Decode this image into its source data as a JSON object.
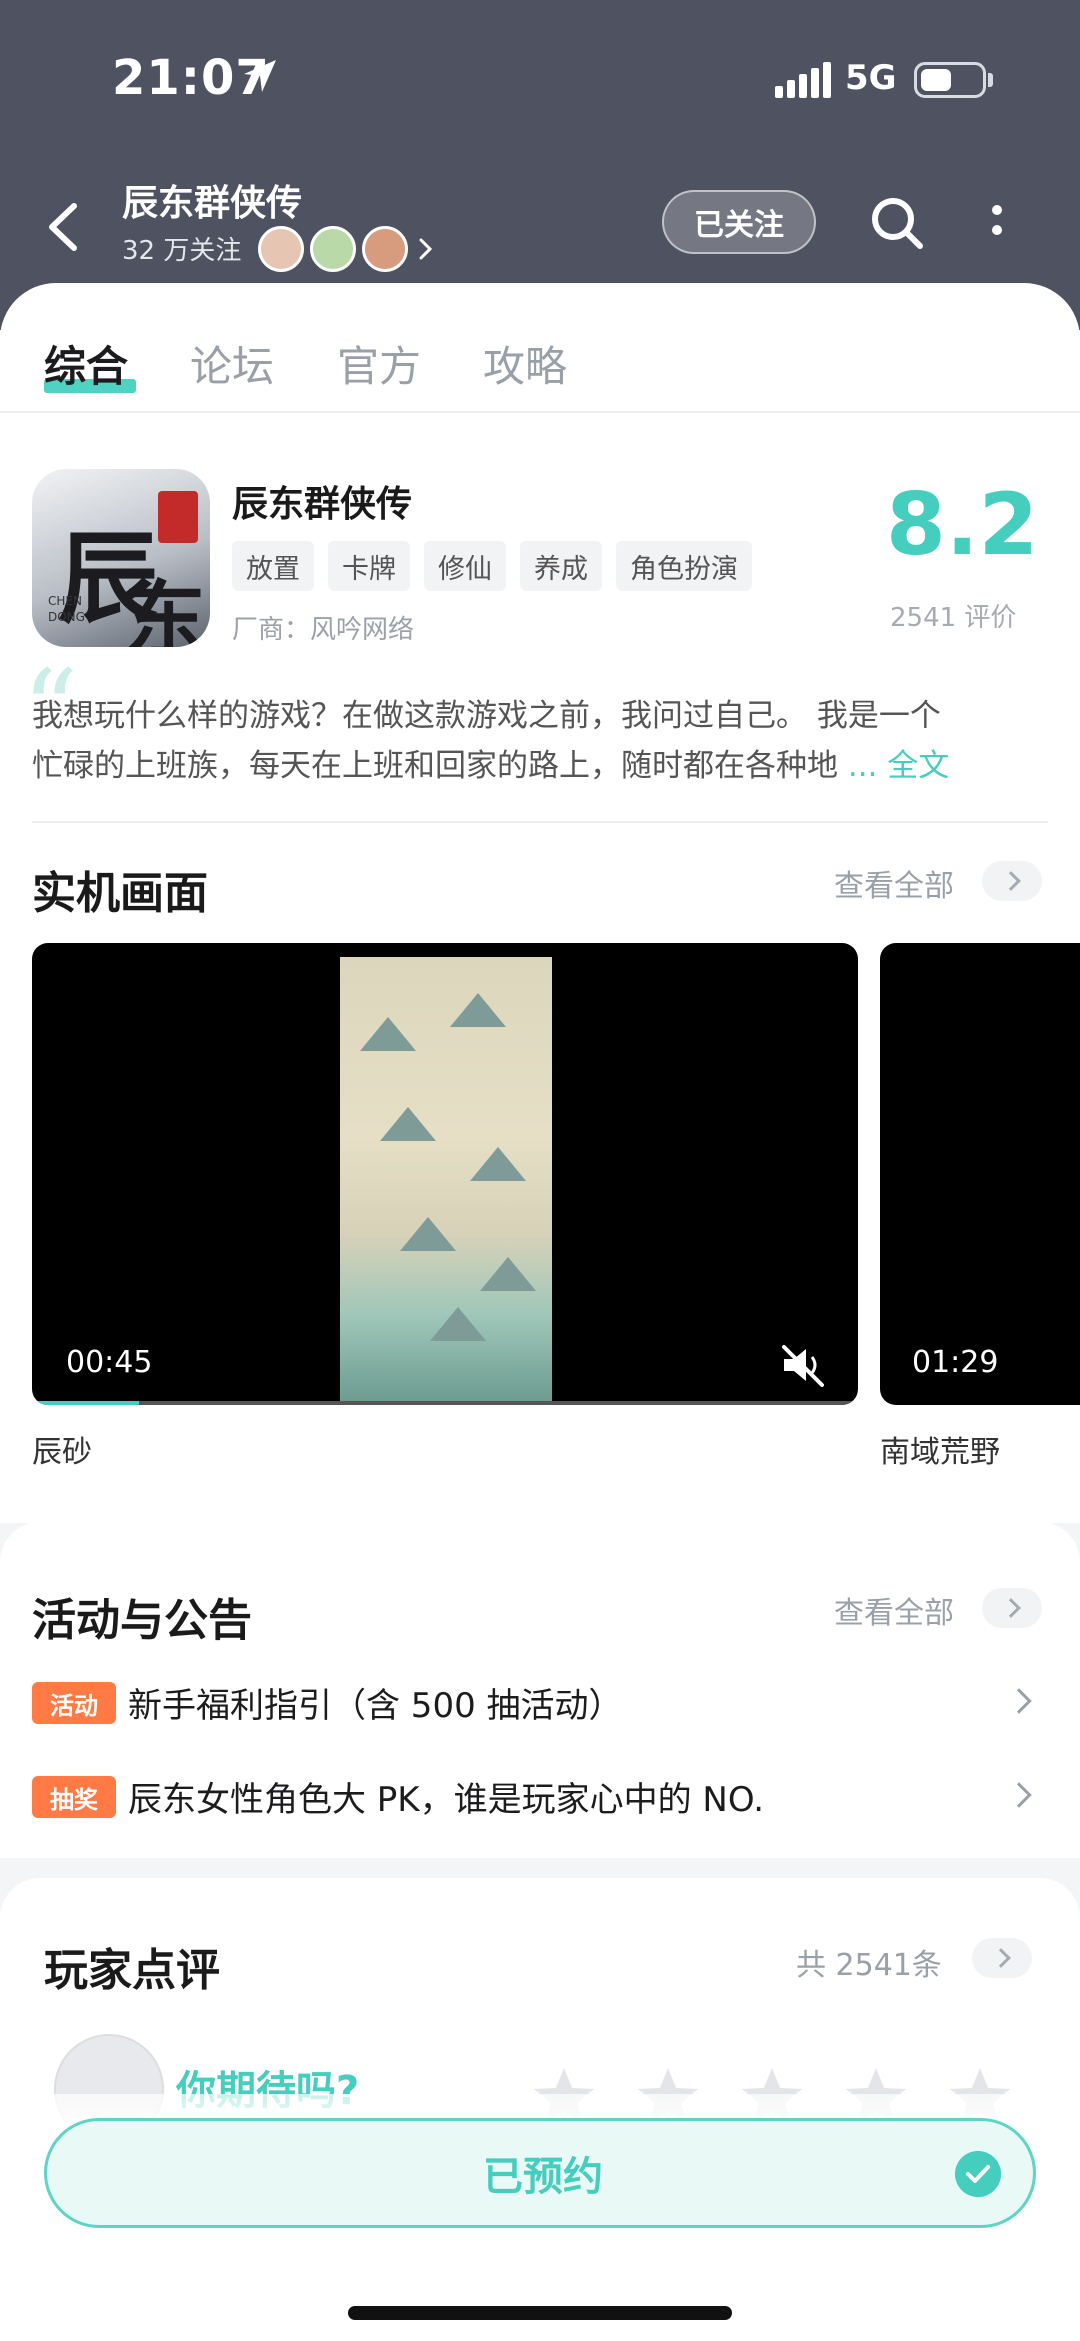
{
  "status_bar": {
    "time": "21:07",
    "network": "5G"
  },
  "header": {
    "title": "辰东群侠传",
    "followers": "32 万关注",
    "follow_button": "已关注"
  },
  "tabs": [
    "综合",
    "论坛",
    "官方",
    "攻略"
  ],
  "game": {
    "name": "辰东群侠传",
    "tags": [
      "放置",
      "卡牌",
      "修仙",
      "养成",
      "角色扮演"
    ],
    "vendor": "厂商：风吟网络",
    "score": "8.2",
    "rating_count": "2541 评价",
    "intro_line1": "我想玩什么样的游戏？在做这款游戏之前，我问过自己。   我是一个",
    "intro_line2": "忙碌的上班族，每天在上班和回家的路上，随时都在各种地",
    "intro_more": "... 全文"
  },
  "screenshots": {
    "title": "实机画面",
    "see_all": "查看全部",
    "videos": [
      {
        "duration": "00:45",
        "caption": "辰砂",
        "progress": 0.13,
        "muted": true
      },
      {
        "duration": "01:29",
        "caption": "南域荒野"
      }
    ]
  },
  "activities": {
    "title": "活动与公告",
    "see_all": "查看全部",
    "items": [
      {
        "badge": "活动",
        "text": "新手福利指引（含 500 抽活动）"
      },
      {
        "badge": "抽奖",
        "text": "辰东女性角色大 PK，谁是玩家心中的 NO."
      }
    ]
  },
  "reviews": {
    "title": "玩家点评",
    "count": "共 2541条",
    "prompt": "你期待吗?",
    "stars": 5
  },
  "reserve_button": "已预约",
  "colors": {
    "accent": "#45cdbd",
    "badge": "#ff7a45",
    "header_bg": "#4f5260"
  }
}
